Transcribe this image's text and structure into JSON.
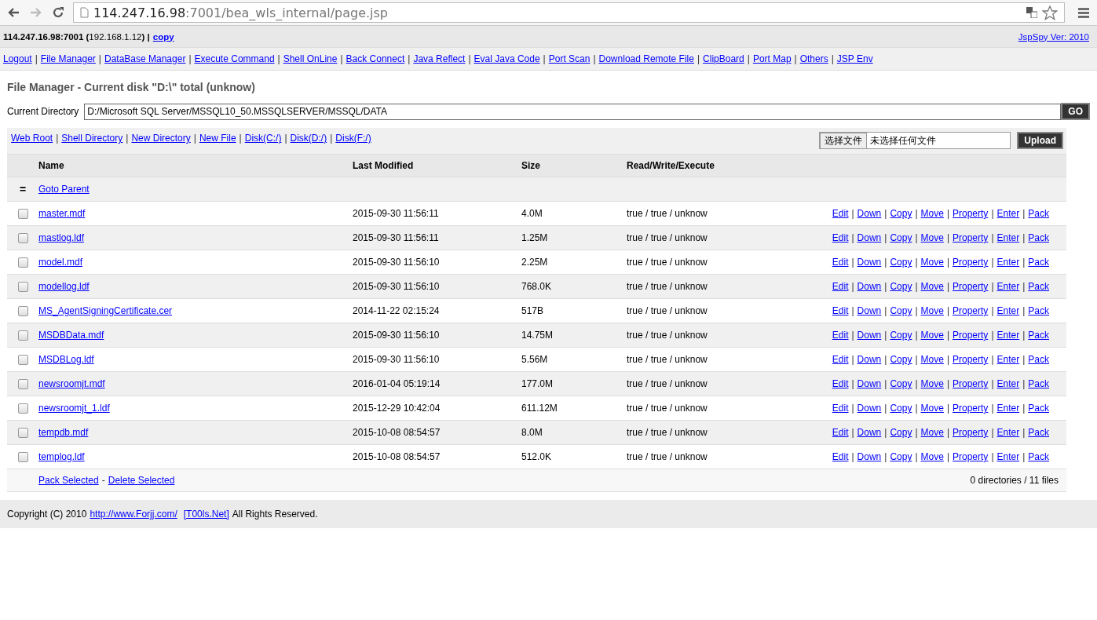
{
  "browser": {
    "url_host": "114.247.16.98",
    "url_rest": ":7001/bea_wls_internal/page.jsp"
  },
  "info_bar": {
    "host": "**114.247.16.98:7001 (**192.168.1.12**) |**",
    "copy_link": "copy",
    "version_link": "JspSpy Ver: 2010"
  },
  "separator": "|",
  "nav": [
    "Logout",
    "File Manager",
    "DataBase Manager",
    "Execute Command",
    "Shell OnLine",
    "Back Connect",
    "Java Reflect",
    "Eval Java Code",
    "Port Scan",
    "Download Remote File",
    "ClipBoard",
    "Port Map",
    "Others",
    "JSP Env"
  ],
  "title": "File Manager - Current disk \"D:\\\" total (unknow)",
  "directory": {
    "label": "Current Directory",
    "value": "D:/Microsoft SQL Server/MSSQL10_50.MSSQLSERVER/MSSQL/DATA",
    "go_button": "GO"
  },
  "dir_links": [
    "Web Root",
    "Shell Directory",
    "New Directory",
    "New File",
    "Disk(C:/)",
    "Disk(D:/)",
    "Disk(F:/)"
  ],
  "upload": {
    "choose_button": "选择文件",
    "file_status": "未选择任何文件",
    "upload_button": "Upload"
  },
  "table": {
    "columns": [
      "Name",
      "Last Modified",
      "Size",
      "Read/Write/Execute"
    ],
    "parent": {
      "icon": "=",
      "link": "Goto Parent"
    },
    "rows": [
      {
        "checked": false,
        "name": "master.mdf",
        "modified": "2015-09-30 11:56:11",
        "size": "4.0M",
        "rwx": "true / true / unknow",
        "actions": [
          "Edit",
          "Down",
          "Copy",
          "Move",
          "Property",
          "Enter",
          "Pack"
        ]
      },
      {
        "checked": false,
        "name": "mastlog.ldf",
        "modified": "2015-09-30 11:56:11",
        "size": "1.25M",
        "rwx": "true / true / unknow",
        "actions": [
          "Edit",
          "Down",
          "Copy",
          "Move",
          "Property",
          "Enter",
          "Pack"
        ]
      },
      {
        "checked": false,
        "name": "model.mdf",
        "modified": "2015-09-30 11:56:10",
        "size": "2.25M",
        "rwx": "true / true / unknow",
        "actions": [
          "Edit",
          "Down",
          "Copy",
          "Move",
          "Property",
          "Enter",
          "Pack"
        ]
      },
      {
        "checked": false,
        "name": "modellog.ldf",
        "modified": "2015-09-30 11:56:10",
        "size": "768.0K",
        "rwx": "true / true / unknow",
        "actions": [
          "Edit",
          "Down",
          "Copy",
          "Move",
          "Property",
          "Enter",
          "Pack"
        ]
      },
      {
        "checked": false,
        "name": "MS_AgentSigningCertificate.cer",
        "modified": "2014-11-22 02:15:24",
        "size": "517B",
        "rwx": "true / true / unknow",
        "actions": [
          "Edit",
          "Down",
          "Copy",
          "Move",
          "Property",
          "Enter",
          "Pack"
        ]
      },
      {
        "checked": false,
        "name": "MSDBData.mdf",
        "modified": "2015-09-30 11:56:10",
        "size": "14.75M",
        "rwx": "true / true / unknow",
        "actions": [
          "Edit",
          "Down",
          "Copy",
          "Move",
          "Property",
          "Enter",
          "Pack"
        ]
      },
      {
        "checked": false,
        "name": "MSDBLog.ldf",
        "modified": "2015-09-30 11:56:10",
        "size": "5.56M",
        "rwx": "true / true / unknow",
        "actions": [
          "Edit",
          "Down",
          "Copy",
          "Move",
          "Property",
          "Enter",
          "Pack"
        ]
      },
      {
        "checked": false,
        "name": "newsroomjt.mdf",
        "modified": "2016-01-04 05:19:14",
        "size": "177.0M",
        "rwx": "true / true / unknow",
        "actions": [
          "Edit",
          "Down",
          "Copy",
          "Move",
          "Property",
          "Enter",
          "Pack"
        ]
      },
      {
        "checked": false,
        "name": "newsroomjt_1.ldf",
        "modified": "2015-12-29 10:42:04",
        "size": "611.12M",
        "rwx": "true / true / unknow",
        "actions": [
          "Edit",
          "Down",
          "Copy",
          "Move",
          "Property",
          "Enter",
          "Pack"
        ]
      },
      {
        "checked": false,
        "name": "tempdb.mdf",
        "modified": "2015-10-08 08:54:57",
        "size": "8.0M",
        "rwx": "true / true / unknow",
        "actions": [
          "Edit",
          "Down",
          "Copy",
          "Move",
          "Property",
          "Enter",
          "Pack"
        ]
      },
      {
        "checked": false,
        "name": "templog.ldf",
        "modified": "2015-10-08 08:54:57",
        "size": "512.0K",
        "rwx": "true / true / unknow",
        "actions": [
          "Edit",
          "Down",
          "Copy",
          "Move",
          "Property",
          "Enter",
          "Pack"
        ]
      }
    ],
    "footer": {
      "pack_link": "Pack Selected",
      "dash": "-",
      "delete_link": "Delete Selected",
      "count": "0 directories / 11 files"
    }
  },
  "footer": {
    "text_before": "Copyright (C) 2010",
    "link1": "http://www.Forjj.com/",
    "link2": "[T00ls.Net]",
    "text_after": "All Rights Reserved."
  }
}
